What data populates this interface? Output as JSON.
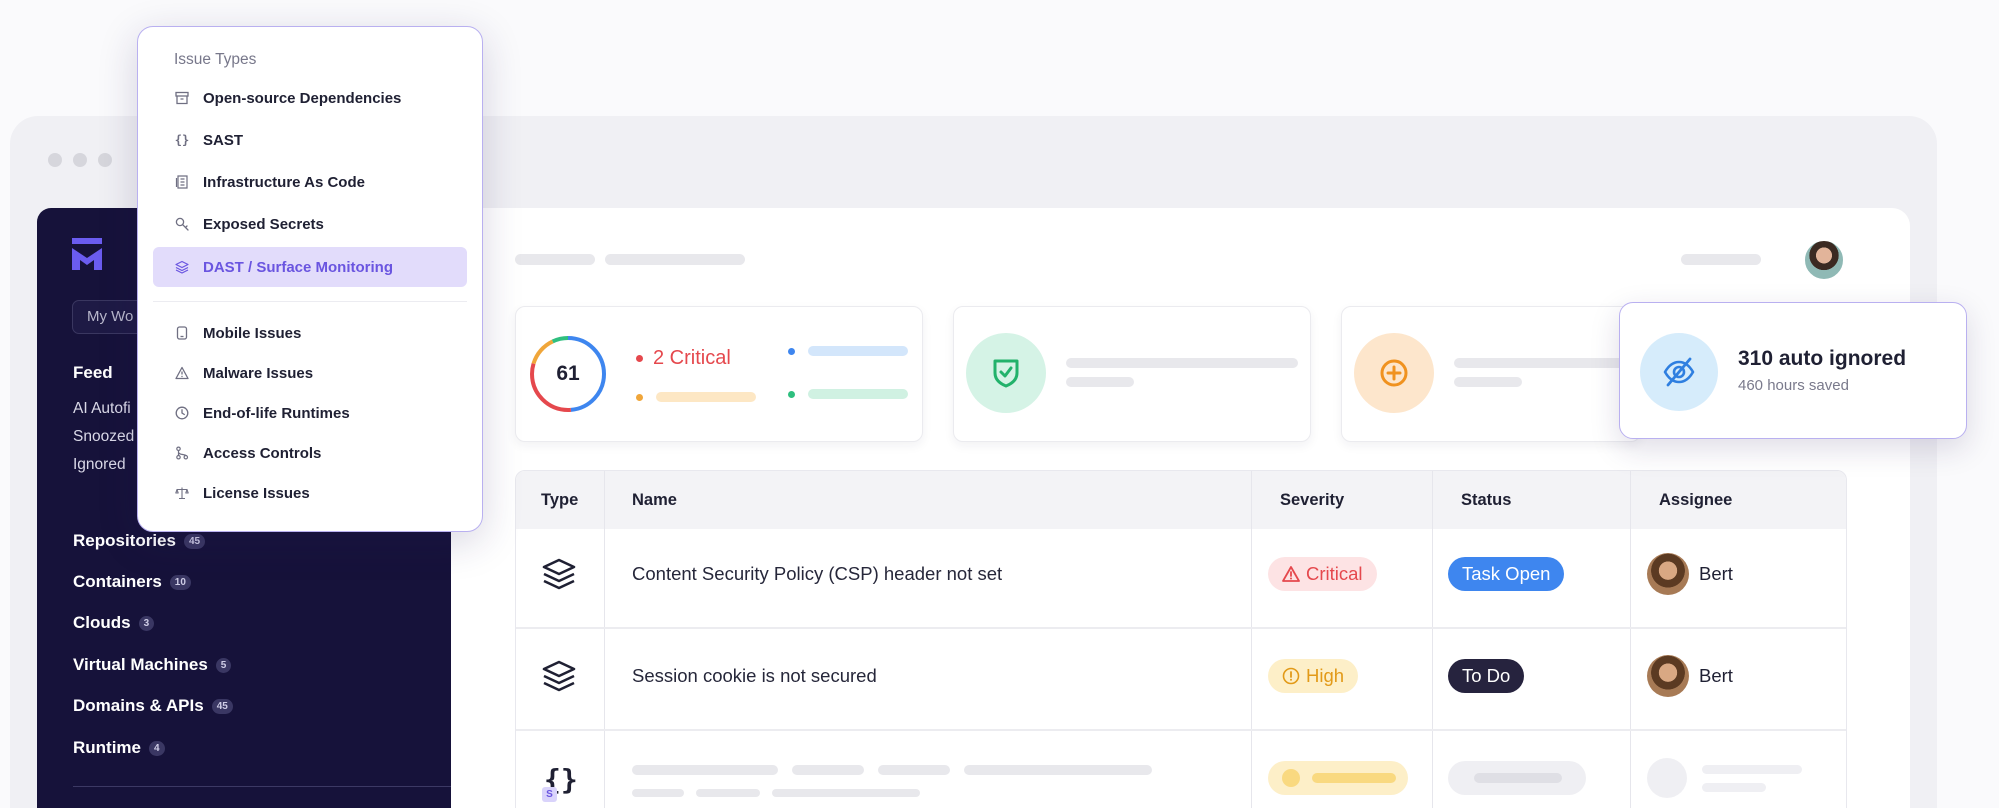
{
  "dropdown": {
    "title": "Issue Types",
    "items": [
      {
        "label": "Open-source Dependencies",
        "icon": "archive-icon"
      },
      {
        "label": "SAST",
        "icon": "braces-icon"
      },
      {
        "label": "Infrastructure As Code",
        "icon": "scroll-icon"
      },
      {
        "label": "Exposed Secrets",
        "icon": "key-search-icon"
      },
      {
        "label": "DAST / Surface Monitoring",
        "icon": "layers-icon",
        "selected": true
      },
      {
        "label": "Mobile Issues",
        "icon": "mobile-icon"
      },
      {
        "label": "Malware Issues",
        "icon": "warning-triangle-icon"
      },
      {
        "label": "End-of-life Runtimes",
        "icon": "clock-icon"
      },
      {
        "label": "Access Controls",
        "icon": "branch-icon"
      },
      {
        "label": "License Issues",
        "icon": "scale-icon"
      }
    ]
  },
  "sidebar": {
    "workspace_label": "My Wo",
    "feed": {
      "title": "Feed",
      "subitems": [
        "AI Autofi",
        "Snoozed",
        "Ignored"
      ]
    },
    "nav": [
      {
        "label": "Repositories",
        "count": "45"
      },
      {
        "label": "Containers",
        "count": "10"
      },
      {
        "label": "Clouds",
        "count": "3"
      },
      {
        "label": "Virtual Machines",
        "count": "5"
      },
      {
        "label": "Domains & APIs",
        "count": "45"
      },
      {
        "label": "Runtime",
        "count": "4"
      }
    ]
  },
  "summary": {
    "score": "61",
    "critical_label": "2 Critical"
  },
  "ignored_card": {
    "title": "310 auto ignored",
    "subtitle": "460 hours saved"
  },
  "table": {
    "headers": {
      "type": "Type",
      "name": "Name",
      "severity": "Severity",
      "status": "Status",
      "assignee": "Assignee"
    },
    "rows": [
      {
        "type_icon": "layers-icon",
        "name": "Content Security Policy (CSP) header not set",
        "severity": "Critical",
        "status": "Task Open",
        "assignee": "Bert"
      },
      {
        "type_icon": "layers-icon",
        "name": "Session cookie is not secured",
        "severity": "High",
        "status": "To Do",
        "assignee": "Bert"
      }
    ],
    "third_row_icon": "braces-icon",
    "third_row_badge": "S"
  },
  "colors": {
    "accent": "#6a55e0",
    "sidebar_bg": "#16123a",
    "critical": "#e5484d",
    "high": "#e29a18",
    "task_open": "#3e86ef"
  }
}
